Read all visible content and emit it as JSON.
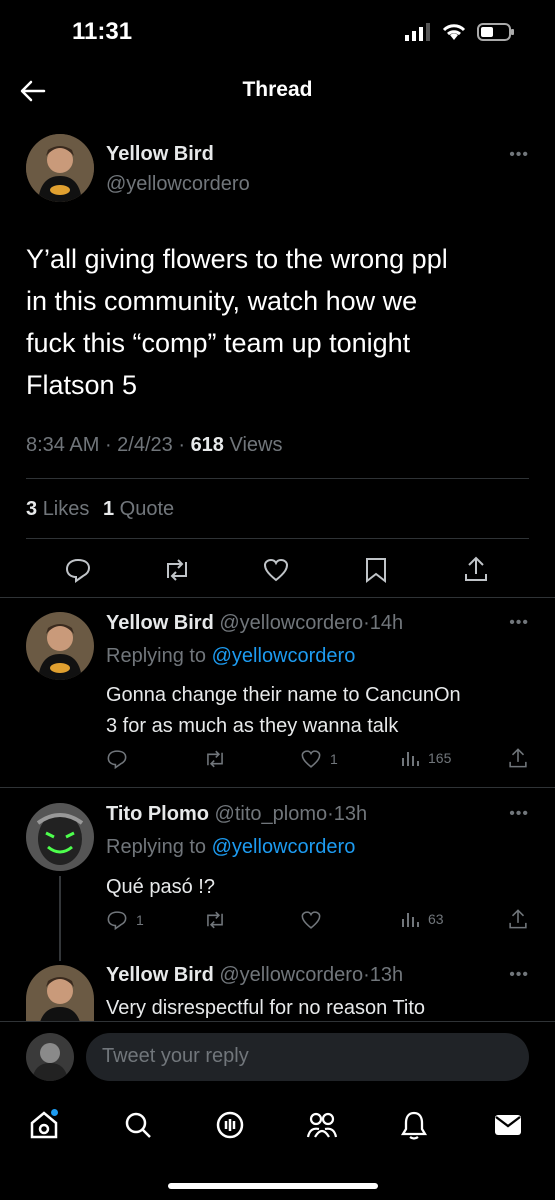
{
  "status_bar": {
    "time": "11:31"
  },
  "header": {
    "title": "Thread"
  },
  "main_tweet": {
    "name": "Yellow Bird",
    "handle": "@yellowcordero",
    "text_lines": [
      "Y’all giving flowers to the wrong ppl",
      "in this community, watch how we",
      "fuck this “comp” team up tonight",
      "Flatson 5"
    ],
    "time": "8:34 AM",
    "date": "2/4/23",
    "views_count": "618",
    "views_label": "Views",
    "likes_count": "3",
    "likes_label": "Likes",
    "quotes_count": "1",
    "quotes_label": "Quote"
  },
  "replies": [
    {
      "name": "Yellow Bird",
      "handle": "@yellowcordero",
      "age": "14h",
      "replying_label": "Replying to",
      "replying_handle": "@yellowcordero",
      "text_lines": [
        "Gonna change their name to CancunOn",
        "3 for as much as they wanna talk"
      ],
      "reply_count": "",
      "like_count": "1",
      "views": "165"
    },
    {
      "name": "Tito Plomo",
      "handle": "@tito_plomo",
      "age": "13h",
      "replying_label": "Replying to",
      "replying_handle": "@yellowcordero",
      "text_lines": [
        "Qué pasó !?"
      ],
      "reply_count": "1",
      "like_count": "",
      "views": "63"
    },
    {
      "name": "Yellow Bird",
      "handle": "@yellowcordero",
      "age": "13h",
      "text_lines": [
        "Very disrespectful for no reason Tito"
      ]
    }
  ],
  "composer": {
    "placeholder": "Tweet your reply"
  },
  "colors": {
    "accent": "#1d9bf0",
    "muted": "#71767b",
    "divider": "#2f3336"
  }
}
